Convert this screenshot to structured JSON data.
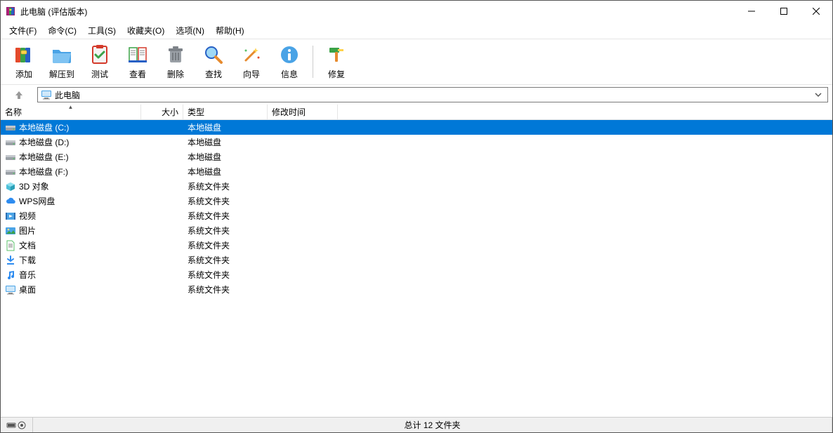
{
  "titlebar": {
    "title": "此电脑 (评估版本)"
  },
  "menu": {
    "file": "文件(F)",
    "command": "命令(C)",
    "tools": "工具(S)",
    "favorites": "收藏夹(O)",
    "options": "选项(N)",
    "help": "帮助(H)"
  },
  "toolbar": {
    "add": "添加",
    "extract": "解压到",
    "test": "测试",
    "view": "查看",
    "delete": "删除",
    "find": "查找",
    "wizard": "向导",
    "info": "信息",
    "repair": "修复"
  },
  "address": {
    "path": "此电脑"
  },
  "columns": {
    "name": "名称",
    "size": "大小",
    "type": "类型",
    "date": "修改时间"
  },
  "rows": [
    {
      "icon": "drive-icon",
      "name": "本地磁盘 (C:)",
      "type": "本地磁盘",
      "selected": true
    },
    {
      "icon": "drive-icon",
      "name": "本地磁盘 (D:)",
      "type": "本地磁盘",
      "selected": false
    },
    {
      "icon": "drive-icon",
      "name": "本地磁盘 (E:)",
      "type": "本地磁盘",
      "selected": false
    },
    {
      "icon": "drive-icon",
      "name": "本地磁盘 (F:)",
      "type": "本地磁盘",
      "selected": false
    },
    {
      "icon": "objects3d-icon",
      "name": "3D 对象",
      "type": "系统文件夹",
      "selected": false
    },
    {
      "icon": "cloud-icon",
      "name": "WPS网盘",
      "type": "系统文件夹",
      "selected": false
    },
    {
      "icon": "video-icon",
      "name": "视频",
      "type": "系统文件夹",
      "selected": false
    },
    {
      "icon": "picture-icon",
      "name": "图片",
      "type": "系统文件夹",
      "selected": false
    },
    {
      "icon": "document-icon",
      "name": "文档",
      "type": "系统文件夹",
      "selected": false
    },
    {
      "icon": "download-icon",
      "name": "下载",
      "type": "系统文件夹",
      "selected": false
    },
    {
      "icon": "music-icon",
      "name": "音乐",
      "type": "系统文件夹",
      "selected": false
    },
    {
      "icon": "desktop-icon",
      "name": "桌面",
      "type": "系统文件夹",
      "selected": false
    }
  ],
  "statusbar": {
    "summary": "总计 12 文件夹"
  }
}
